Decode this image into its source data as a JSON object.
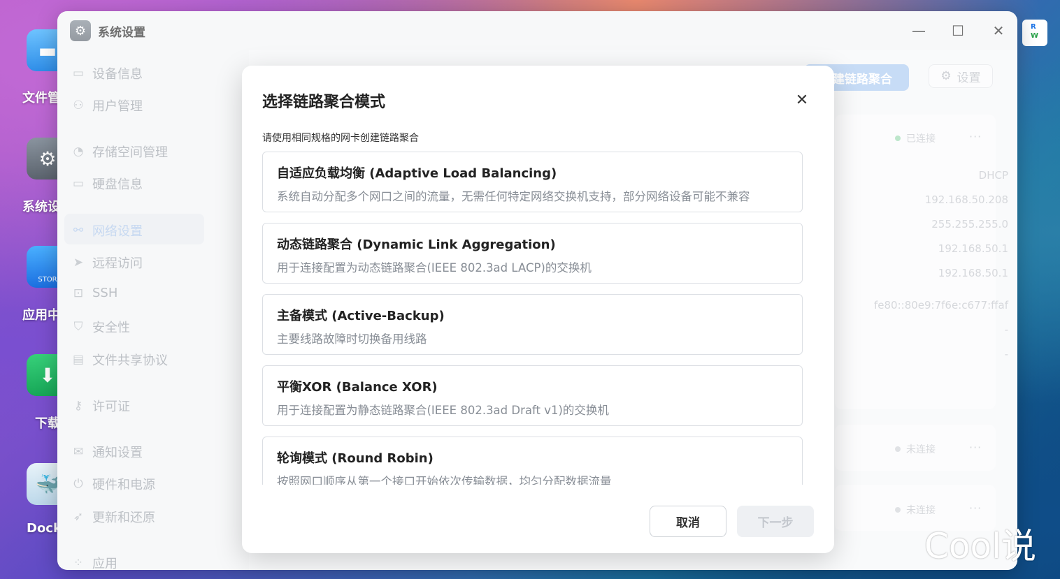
{
  "desktop": {
    "icons": [
      {
        "label": "文件管",
        "name": "files"
      },
      {
        "label": "系统设",
        "name": "settings"
      },
      {
        "label": "应用中",
        "name": "appstore",
        "sub": "STOR"
      },
      {
        "label": "下载",
        "name": "download"
      },
      {
        "label": "Dock",
        "name": "docker"
      }
    ],
    "badge": {
      "r": "R",
      "w": "W"
    },
    "watermark": "Cool说"
  },
  "window": {
    "title": "系统设置",
    "controls": {
      "minimize": "—",
      "maximize": "☐",
      "close": "✕"
    }
  },
  "sidebar": {
    "items": [
      {
        "label": "设备信息",
        "icon": "drive-icon"
      },
      {
        "label": "用户管理",
        "icon": "users-icon"
      },
      {
        "label": "存储空间管理",
        "icon": "storage-icon"
      },
      {
        "label": "硬盘信息",
        "icon": "disk-icon"
      },
      {
        "label": "网络设置",
        "icon": "network-icon",
        "active": true
      },
      {
        "label": "远程访问",
        "icon": "send-icon"
      },
      {
        "label": "SSH",
        "icon": "terminal-icon"
      },
      {
        "label": "安全性",
        "icon": "shield-icon"
      },
      {
        "label": "文件共享协议",
        "icon": "file-icon"
      },
      {
        "label": "许可证",
        "icon": "key-icon"
      },
      {
        "label": "通知设置",
        "icon": "mail-icon"
      },
      {
        "label": "硬件和电源",
        "icon": "power-icon"
      },
      {
        "label": "更新和还原",
        "icon": "rocket-icon"
      },
      {
        "label": "应用",
        "icon": "apps-icon"
      }
    ]
  },
  "content": {
    "new_bond_button": "新建链路聚合",
    "settings_button": "设置",
    "interfaces": [
      {
        "status": "已连接",
        "status_color": "#9ad9b0",
        "values": [
          "DHCP",
          "192.168.50.208",
          "255.255.255.0",
          "192.168.50.1",
          "192.168.50.1",
          "fe80::80e9:7f6e:c677:ffaf",
          "-",
          "-"
        ]
      },
      {
        "status": "未连接",
        "status_color": "#d0d3d8"
      },
      {
        "status": "未连接",
        "status_color": "#d0d3d8"
      }
    ],
    "more_glyph": "···"
  },
  "dialog": {
    "title": "选择链路聚合模式",
    "hint": "请使用相同规格的网卡创建链路聚合",
    "options": [
      {
        "title": "自适应负载均衡 (Adaptive Load Balancing)",
        "desc": "系统自动分配多个网口之间的流量，无需任何特定网络交换机支持，部分网络设备可能不兼容"
      },
      {
        "title": "动态链路聚合 (Dynamic Link Aggregation)",
        "desc": "用于连接配置为动态链路聚合(IEEE 802.3ad LACP)的交换机"
      },
      {
        "title": "主备模式 (Active-Backup)",
        "desc": "主要线路故障时切换备用线路"
      },
      {
        "title": "平衡XOR (Balance XOR)",
        "desc": "用于连接配置为静态链路聚合(IEEE 802.3ad Draft v1)的交换机"
      },
      {
        "title": "轮询模式 (Round Robin)",
        "desc": "按照网口顺序从第一个接口开始依次传输数据，均匀分配数据流量"
      }
    ],
    "cancel": "取消",
    "next": "下一步",
    "close_glyph": "✕"
  }
}
